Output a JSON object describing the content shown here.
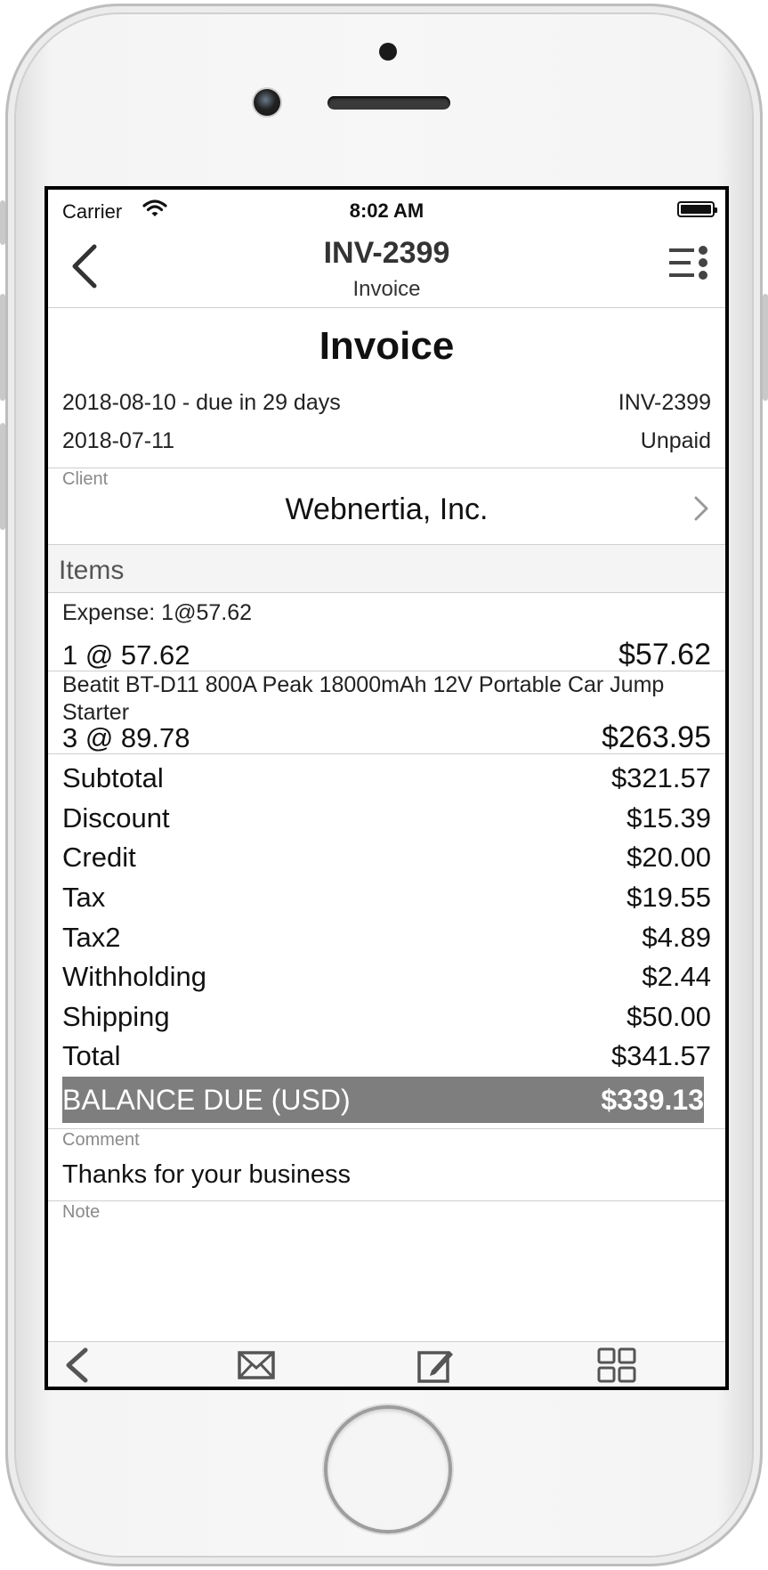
{
  "status": {
    "carrier": "Carrier",
    "time": "8:02 AM"
  },
  "nav": {
    "title": "INV-2399",
    "subtitle": "Invoice"
  },
  "doc": {
    "heading": "Invoice",
    "date_line": "2018-08-10 - due in 29 days",
    "number": "INV-2399",
    "issue_date": "2018-07-11",
    "status": "Unpaid"
  },
  "client": {
    "label": "Client",
    "name": "Webnertia, Inc."
  },
  "items_section": "Items",
  "items": [
    {
      "description": "Expense: 1@57.62",
      "qty": "1 @ 57.62",
      "amount": "$57.62"
    },
    {
      "description": "Beatit BT-D11 800A Peak 18000mAh 12V Portable Car Jump Starter",
      "qty": "3 @ 89.78",
      "amount": "$263.95"
    }
  ],
  "totals": [
    {
      "label": "Subtotal",
      "value": "$321.57"
    },
    {
      "label": "Discount",
      "value": "$15.39"
    },
    {
      "label": "Credit",
      "value": "$20.00"
    },
    {
      "label": "Tax",
      "value": "$19.55"
    },
    {
      "label": "Tax2",
      "value": "$4.89"
    },
    {
      "label": "Withholding",
      "value": "$2.44"
    },
    {
      "label": "Shipping",
      "value": "$50.00"
    },
    {
      "label": "Total",
      "value": "$341.57"
    }
  ],
  "balance": {
    "label": "BALANCE DUE (USD)",
    "value": "$339.13",
    "color": "#7e7e7e"
  },
  "comment": {
    "label": "Comment",
    "text": "Thanks for your business"
  },
  "note": {
    "label": "Note"
  },
  "toolbar": {
    "icons": [
      "back-icon",
      "mail-icon",
      "edit-icon",
      "grid-icon"
    ]
  }
}
